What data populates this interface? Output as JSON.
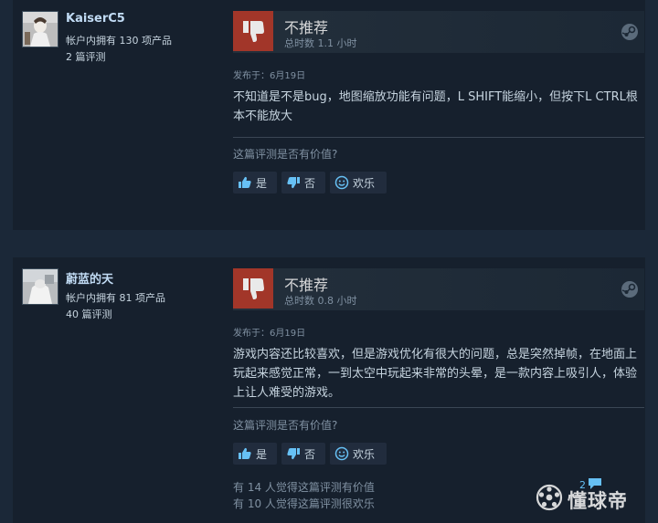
{
  "reviews": [
    {
      "author": "KaiserC5",
      "products_owned": "帐户内拥有 130 项产品",
      "review_count": "2 篇评测",
      "verdict": "不推荐",
      "hours": "总时数 1.1 小时",
      "posted": "发布于：6月19日",
      "text": "不知道是不是bug，地图缩放功能有问题，L SHIFT能缩小，但按下L CTRL根本不能放大",
      "helpful_question": "这篇评测是否有价值?",
      "btn_yes": "是",
      "btn_no": "否",
      "btn_funny": "欢乐"
    },
    {
      "author": "蔚蓝的天",
      "products_owned": "帐户内拥有 81 项产品",
      "review_count": "40 篇评测",
      "verdict": "不推荐",
      "hours": "总时数 0.8 小时",
      "posted": "发布于：6月19日",
      "text": "游戏内容还比较喜欢，但是游戏优化有很大的问题，总是突然掉帧，在地面上玩起来感觉正常，一到太空中玩起来非常的头晕，是一款内容上吸引人，体验上让人难受的游戏。",
      "helpful_question": "这篇评测是否有价值?",
      "btn_yes": "是",
      "btn_no": "否",
      "btn_funny": "欢乐",
      "found_helpful": "有 14 人觉得这篇评测有价值",
      "found_funny": "有 10 人觉得这篇评测很欢乐",
      "comment_count": "2"
    }
  ],
  "watermark": "懂球帝",
  "colors": {
    "page_bg": "#1b2838",
    "card_bg": "#16202d",
    "thumb_down": "#a23629",
    "link_blue": "#66c0f4"
  },
  "icons": [
    "thumbs-down-icon",
    "steam-icon",
    "thumbs-up-icon",
    "smiley-icon",
    "comment-icon",
    "soccer-ball-icon"
  ]
}
